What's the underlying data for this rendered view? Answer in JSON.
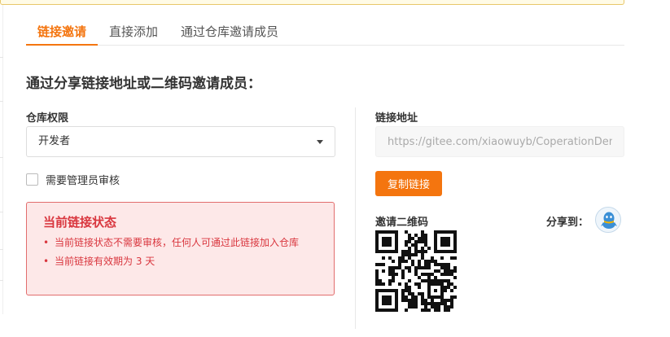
{
  "tabs": [
    {
      "label": "链接邀请",
      "active": true
    },
    {
      "label": "直接添加",
      "active": false
    },
    {
      "label": "通过仓库邀请成员",
      "active": false
    }
  ],
  "heading": "通过分享链接地址或二维码邀请成员：",
  "permission": {
    "label": "仓库权限",
    "selected": "开发者"
  },
  "approval_checkbox": {
    "label": "需要管理员审核",
    "checked": false
  },
  "status": {
    "title": "当前链接状态",
    "items": [
      "当前链接状态不需要审核，任何人可通过此链接加入仓库",
      "当前链接有效期为 3 天"
    ]
  },
  "link": {
    "label": "链接地址",
    "value": "https://gitee.com/xiaowuyb/CoperationDemo"
  },
  "copy_button": "复制链接",
  "qr_label": "邀请二维码",
  "share_label": "分享到：",
  "share_targets": [
    "qq-icon"
  ],
  "colors": {
    "accent": "#f4750f",
    "error": "#d9363e",
    "error_bg": "#fde8e8"
  }
}
